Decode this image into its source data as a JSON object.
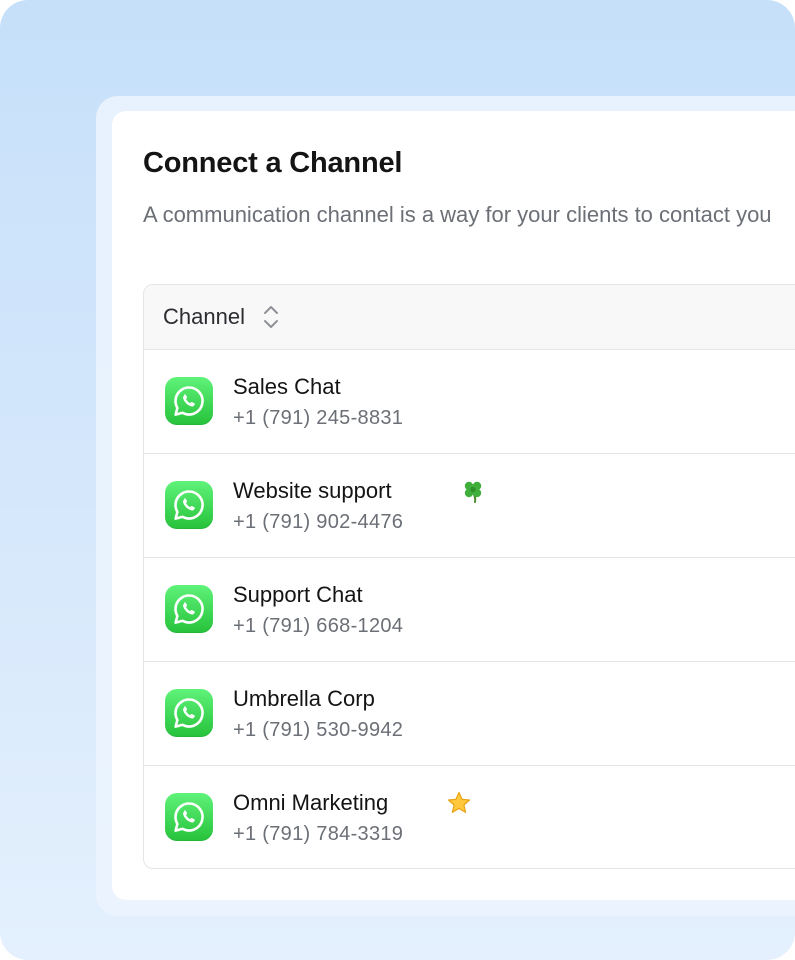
{
  "dialog": {
    "title": "Connect a Channel",
    "subtitle": "A communication channel is a way for your clients to contact you"
  },
  "table": {
    "column_header": "Channel",
    "sort_icon": "sort-updown-icon",
    "rows": [
      {
        "name": "Sales Chat",
        "phone": "+1 (791) 245-8831",
        "icon": "whatsapp-icon",
        "badge": ""
      },
      {
        "name": "Website support",
        "phone": "+1 (791) 902-4476",
        "icon": "whatsapp-icon",
        "badge": "clover-emoji"
      },
      {
        "name": "Support Chat",
        "phone": "+1 (791) 668-1204",
        "icon": "whatsapp-icon",
        "badge": ""
      },
      {
        "name": "Umbrella Corp",
        "phone": "+1 (791) 530-9942",
        "icon": "whatsapp-icon",
        "badge": ""
      },
      {
        "name": "Omni Marketing",
        "phone": "+1 (791) 784-3319",
        "icon": "whatsapp-icon",
        "badge": "star-emoji"
      }
    ]
  },
  "colors": {
    "background": "#c6e0fa",
    "whatsapp_green": "#27c23b",
    "text_primary": "#141414",
    "text_secondary": "#6b6f76",
    "border": "#e4e5e8"
  }
}
